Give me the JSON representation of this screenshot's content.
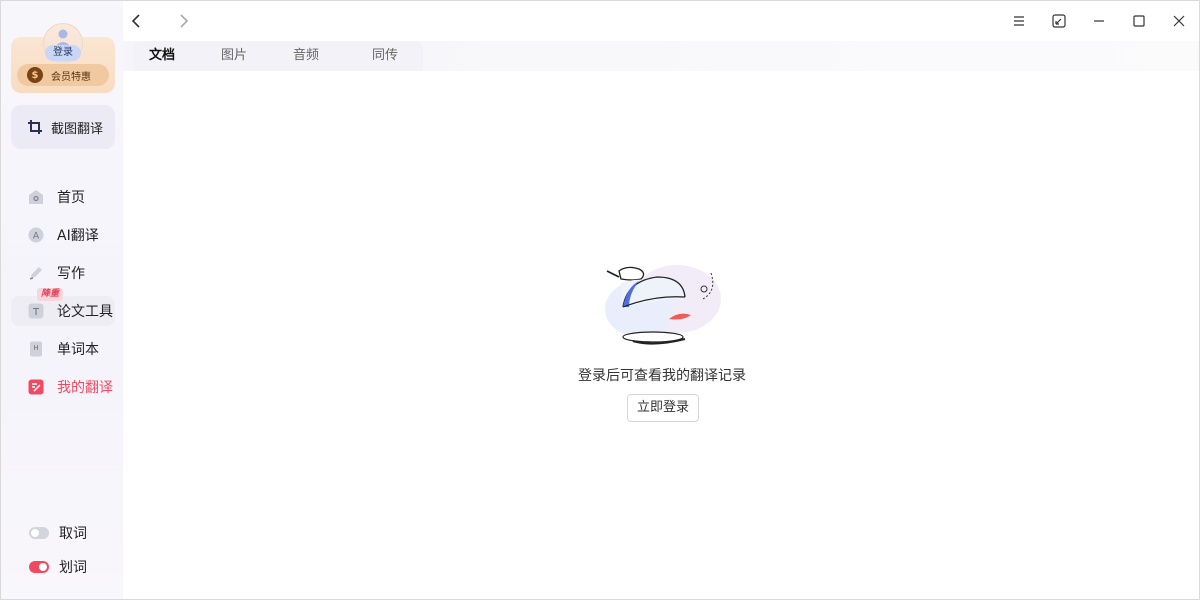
{
  "sidebar": {
    "login_label": "登录",
    "vip_label": "会员特惠",
    "screenshot_translate": "截图翻译",
    "nav": [
      {
        "label": "首页",
        "icon": "home-icon"
      },
      {
        "label": "AI翻译",
        "icon": "ai-icon"
      },
      {
        "label": "写作",
        "icon": "pen-icon"
      },
      {
        "label": "论文工具",
        "icon": "text-icon",
        "badge": "降重"
      },
      {
        "label": "单词本",
        "icon": "wordbook-icon"
      },
      {
        "label": "我的翻译",
        "icon": "my-translation-icon"
      }
    ],
    "toggles": [
      {
        "label": "取词",
        "state": "off"
      },
      {
        "label": "划词",
        "state": "on"
      }
    ]
  },
  "tabs": [
    "文档",
    "图片",
    "音频",
    "同传"
  ],
  "active_tab": "文档",
  "main": {
    "empty_message": "登录后可查看我的翻译记录",
    "login_button": "立即登录"
  },
  "colors": {
    "accent": "#f04a63",
    "vip": "#f1c9a0"
  }
}
